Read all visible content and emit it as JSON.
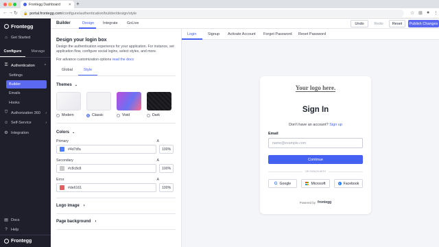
{
  "browser": {
    "tab_title": "Frontegg Dashboard",
    "url_host": "portal.frontegg.com",
    "url_path": "/configure/authentication/builder/design/style"
  },
  "sidebar": {
    "brand": "Frontegg",
    "get_started": "Get Started",
    "mode_tabs": [
      "Configure",
      "Manage"
    ],
    "authentication": "Authentication",
    "auth_items": [
      "Settings",
      "Builder",
      "Emails",
      "Hooks"
    ],
    "authorization": "Authorization 360",
    "self_service": "Self-Service",
    "integration": "Integration",
    "docs": "Docs",
    "help": "Help",
    "footer_brand": "Frontegg"
  },
  "header": {
    "section": "Builder",
    "tabs": [
      "Design",
      "Integrate",
      "GoLive"
    ],
    "undo": "Undo",
    "redo": "Redo",
    "reset": "Reset",
    "publish": "Publish Changes"
  },
  "panel": {
    "title": "Design your login box",
    "description": "Design the authentication experience for your application. For instance, set application flow, configure social logins, select styles, and more.",
    "advanced_prefix": "For advance customization options ",
    "advanced_link": "read the docs",
    "subtabs": [
      "Global",
      "Style"
    ],
    "themes_label": "Themes",
    "themes": [
      "Modern",
      "Classic",
      "Vivid",
      "Dark"
    ],
    "selected_theme": "Classic",
    "colors_label": "Colors",
    "alpha_label": "A",
    "colors": [
      {
        "label": "Primary",
        "hex": "#4d7dfa",
        "alpha": "100%",
        "swatch": "#4d7dfa"
      },
      {
        "label": "Secondary",
        "hex": "#c8c8c8",
        "alpha": "100%",
        "swatch": "#c8c8c8"
      },
      {
        "label": "Error",
        "hex": "#de6161",
        "alpha": "100%",
        "swatch": "#de6161"
      }
    ],
    "logo_image": "Logo image",
    "page_background": "Page background"
  },
  "preview": {
    "tabs": [
      "Login",
      "Signup",
      "Activate Account",
      "Forget Password",
      "Reset Password"
    ],
    "logo_placeholder": "Your logo here.",
    "title": "Sign In",
    "no_account": "Don't have an account? ",
    "signup_link": "Sign up",
    "email_label": "Email",
    "email_placeholder": "name@example.com",
    "continue": "Continue",
    "or_text": "OR SIGN IN WITH",
    "socials": [
      "Google",
      "Microsoft",
      "Facebook"
    ],
    "powered_by": "Powered by",
    "powered_brand": "frontegg"
  },
  "colors": {
    "accent": "#4461f2",
    "sidebar_bg": "#1e1f2b",
    "publish_bg": "#5b68f0"
  }
}
